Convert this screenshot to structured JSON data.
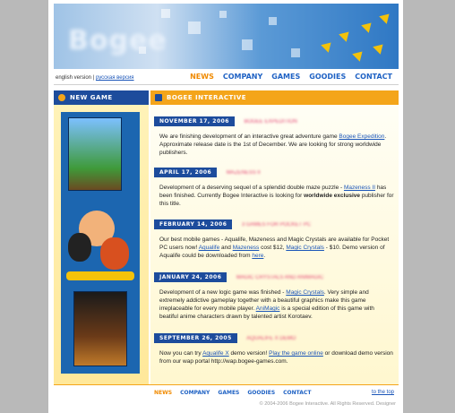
{
  "lang": {
    "english": "english version",
    "separator": "|",
    "russian": "русская версия"
  },
  "nav": [
    "NEWS",
    "COMPANY",
    "GAMES",
    "GOODIES",
    "CONTACT"
  ],
  "sidebar_title": "NEW GAME",
  "main_title": "BOGEE INTERACTIVE",
  "news": [
    {
      "date": "NOVEMBER 17, 2006",
      "title": "BOGEE EXPEDITION",
      "t1": "We are finishing development of an interactive great adventure game ",
      "link1": "Bogee Expedition",
      "t2": ". Approximate release date is the 1st of December. We are looking for strong worldwide publishers."
    },
    {
      "date": "APRIL 17, 2006",
      "title": "MAZENESS II",
      "t1": "Development of a deserving sequel of a splendid double maze puzzle - ",
      "link1": "Mazeness II",
      "t2": " has been finished. Currently Bogee Interactive is looking for ",
      "bold": "worldwide exclusive",
      "t3": " publisher for this title."
    },
    {
      "date": "FEBRUARY 14, 2006",
      "title": "3 GAMES FOR POCKET PC",
      "t1": "Our best mobile games - Aqualife, Mazeness and Magic Crystals are available for Pocket PC users now! ",
      "link1": "Aqualife",
      "t2": " and ",
      "link2": "Mazeness",
      "t3": " cost $12, ",
      "link3": "Magic Crystals",
      "t4": " - $10. Demo version of Aqualife could be downloaded from ",
      "link4": "here",
      "t5": "."
    },
    {
      "date": "JANUARY 24, 2006",
      "title": "MAGIC CRYSTALS AND ANIMAGIC",
      "t1": "Development of a new logic game was finished - ",
      "link1": "Magic Crystals",
      "t2": ". Very simple and extremely addictive gameplay together with a beautiful graphics make this game irreplaceable for every mobile player. ",
      "link2": "AniMagic",
      "t3": " is a special edition of this game with beatiful anime characters drawn by talented artist Korotaev."
    },
    {
      "date": "SEPTEMBER 26, 2005",
      "title": "AQUALIFE X DEMO",
      "t1": "Now you can try ",
      "link1": "Aqualife X",
      "t2": " demo version! ",
      "link2": "Play the game online",
      "t3": " or download demo version from our wap portal http://wap.bogee-games.com."
    }
  ],
  "bottom_nav": [
    "NEWS",
    "COMPANY",
    "GAMES",
    "GOODIES",
    "CONTACT"
  ],
  "to_top": "to the top",
  "footer": "© 2004-2006 Bogee Interactive. All Rights Reserved. Designer",
  "colors": {
    "nav_blue": "#1f62c4",
    "active_orange": "#f08a00",
    "date_bg": "#1d4c9c",
    "main_header": "#f4a51a"
  },
  "icons": [
    "bogee-logo",
    "arrow-decoration-icon",
    "bullet-icon"
  ]
}
